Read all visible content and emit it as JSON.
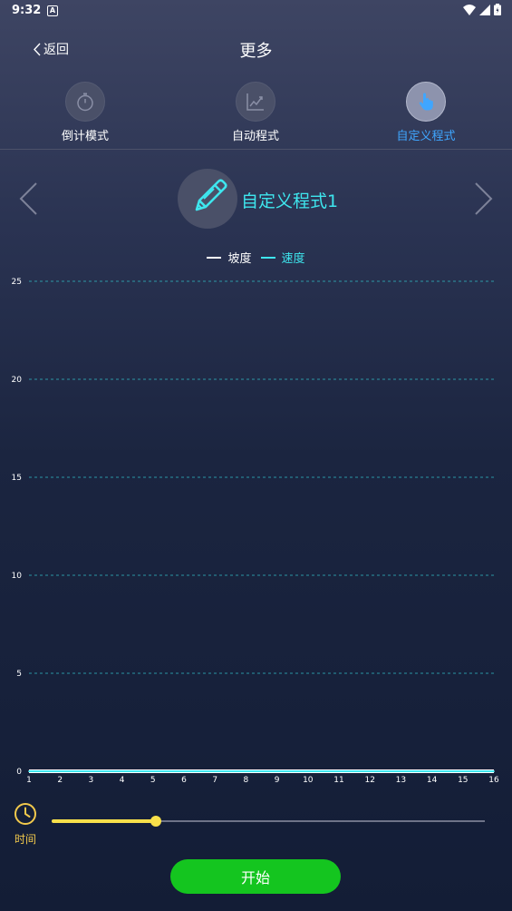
{
  "status_bar": {
    "time": "9:32",
    "notification_icon": "A"
  },
  "header": {
    "back_label": "返回",
    "title": "更多"
  },
  "modes": [
    {
      "label": "倒计模式",
      "icon": "stopwatch-icon",
      "active": false
    },
    {
      "label": "自动程式",
      "icon": "line-chart-icon",
      "active": false
    },
    {
      "label": "自定义程式",
      "icon": "hand-pointer-icon",
      "active": true
    }
  ],
  "program": {
    "name": "自定义程式1",
    "icon": "pencil-icon"
  },
  "legend": {
    "incline_label": "坡度",
    "speed_label": "速度"
  },
  "colors": {
    "incline": "#ffffff",
    "speed": "#3ee6ee",
    "accent": "#3fa6ff",
    "slider": "#f8e04a",
    "start_button": "#14c51f"
  },
  "chart_data": {
    "type": "line",
    "x": [
      1,
      2,
      3,
      4,
      5,
      6,
      7,
      8,
      9,
      10,
      11,
      12,
      13,
      14,
      15,
      16
    ],
    "series": [
      {
        "name": "坡度",
        "values": [
          0,
          0,
          0,
          0,
          0,
          0,
          0,
          0,
          0,
          0,
          0,
          0,
          0,
          0,
          0,
          0
        ]
      },
      {
        "name": "速度",
        "values": [
          0,
          0,
          0,
          0,
          0,
          0,
          0,
          0,
          0,
          0,
          0,
          0,
          0,
          0,
          0,
          0
        ]
      }
    ],
    "yticks": [
      0,
      5,
      10,
      15,
      20,
      25
    ],
    "ylim": [
      0,
      25
    ],
    "grid": true
  },
  "time_control": {
    "label": "时间",
    "slider_fraction": 0.24
  },
  "start_button": {
    "label": "开始"
  }
}
